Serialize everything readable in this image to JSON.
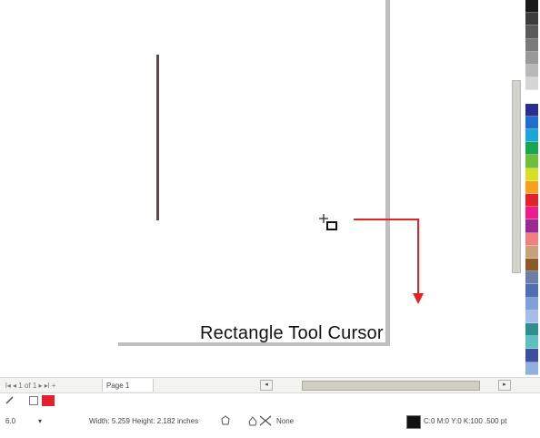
{
  "annotation": {
    "callout_text": "Rectangle Tool Cursor",
    "color": "#e32222"
  },
  "canvas": {
    "cursor_icon": "rectangle-tool-cursor-icon"
  },
  "palette": {
    "colors": [
      "#1a1a1a",
      "#3d3d3d",
      "#5a5a5a",
      "#7a7a7a",
      "#999999",
      "#b8b8b8",
      "#d6d6d6",
      "#ffffff",
      "#2a2f8f",
      "#1e6fd0",
      "#19a7d8",
      "#18a650",
      "#6fbf3c",
      "#d7df23",
      "#f5a11c",
      "#e4202f",
      "#ec1c8c",
      "#9a2a8f",
      "#f08080",
      "#c8a07a",
      "#8b5a2b",
      "#6b7fa6",
      "#4f6fb2",
      "#7fa0d8",
      "#a6bde8",
      "#2d8f8f",
      "#5ec0c0",
      "#3f4f9f",
      "#8fb0e0"
    ]
  },
  "page_tabs_bar": {
    "nav_controls": "l◂ ◂  1 of 1  ▸ ▸l  +",
    "page_tab_label": "Page 1",
    "scroll_left": "◂",
    "scroll_right": "▸"
  },
  "fill_row": {
    "pen_icon": "pen-icon",
    "fill_icon": "fill-icon",
    "fill_color": "#e4202f"
  },
  "status_bar": {
    "snap_value": "6.0",
    "dims": "Width: 5.259  Height: 2.182  inches",
    "fill_label": "None",
    "color_readout": "C:0 M:0 Y:0 K:100  .500 pt"
  }
}
